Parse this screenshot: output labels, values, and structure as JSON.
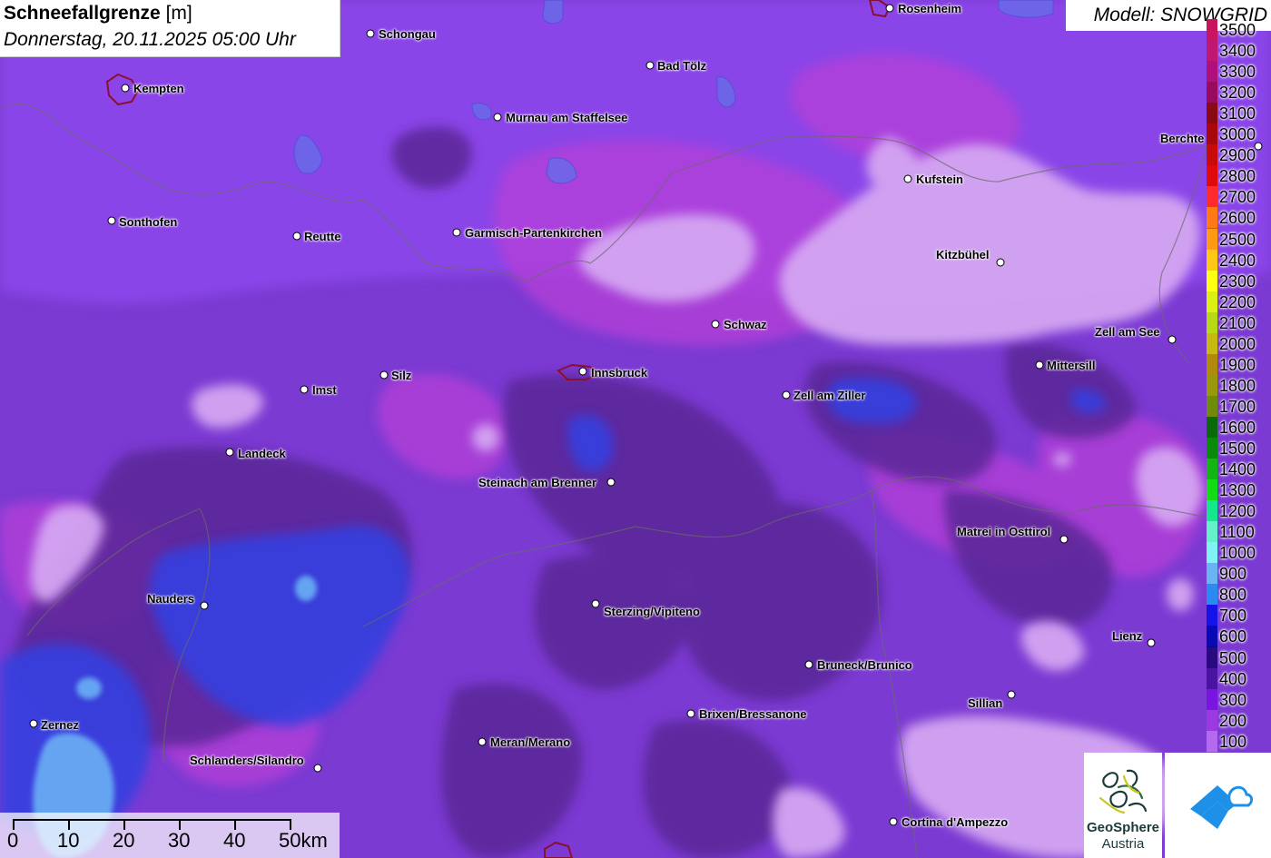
{
  "title": {
    "main": "Schneefallgrenze",
    "unit": "[m]",
    "datetime": "Donnerstag, 20.11.2025 05:00 Uhr"
  },
  "model": {
    "label": "Modell: SNOWGRID"
  },
  "cities": [
    {
      "name": "Rosenheim"
    },
    {
      "name": "Schongau"
    },
    {
      "name": "Bad Tölz"
    },
    {
      "name": "Kempten"
    },
    {
      "name": "Murnau am Staffelsee"
    },
    {
      "name": "Berchte"
    },
    {
      "name": "Kufstein"
    },
    {
      "name": "Sonthofen"
    },
    {
      "name": "Reutte"
    },
    {
      "name": "Garmisch-Partenkirchen"
    },
    {
      "name": "Kitzbühel"
    },
    {
      "name": "Schwaz"
    },
    {
      "name": "Zell am See"
    },
    {
      "name": "Mittersill"
    },
    {
      "name": "Innsbruck"
    },
    {
      "name": "Silz"
    },
    {
      "name": "Imst"
    },
    {
      "name": "Zell am Ziller"
    },
    {
      "name": "Landeck"
    },
    {
      "name": "Steinach am Brenner"
    },
    {
      "name": "Matrei in Osttirol"
    },
    {
      "name": "Nauders"
    },
    {
      "name": "Sterzing/Vipiteno"
    },
    {
      "name": "Lienz"
    },
    {
      "name": "Bruneck/Brunico"
    },
    {
      "name": "Sillian"
    },
    {
      "name": "Brixen/Bressanone"
    },
    {
      "name": "Zernez"
    },
    {
      "name": "Meran/Merano"
    },
    {
      "name": "Schlanders/Silandro"
    },
    {
      "name": "Cortina d'Ampezzo"
    }
  ],
  "legend": {
    "values": [
      "3500",
      "3400",
      "3300",
      "3200",
      "3100",
      "3000",
      "2900",
      "2800",
      "2700",
      "2600",
      "2500",
      "2400",
      "2300",
      "2200",
      "2100",
      "2000",
      "1900",
      "1800",
      "1700",
      "1600",
      "1500",
      "1400",
      "1300",
      "1200",
      "1100",
      "1000",
      "900",
      "800",
      "700",
      "600",
      "500",
      "400",
      "300",
      "200",
      "100"
    ],
    "colors": [
      "#c8155e",
      "#c01870",
      "#b0107a",
      "#9a0a5e",
      "#8a0a14",
      "#a8080c",
      "#c80a0a",
      "#e00a0a",
      "#ff2a2a",
      "#ff7a14",
      "#ff9a14",
      "#ffc814",
      "#ffff14",
      "#d8f014",
      "#b8d814",
      "#c8b814",
      "#b08a0a",
      "#98980a",
      "#708a0a",
      "#0a6a0a",
      "#0a8a0a",
      "#14b414",
      "#14dc14",
      "#14e88a",
      "#64f0c8",
      "#80f4f4",
      "#6ab4f4",
      "#2a8af0",
      "#1414e8",
      "#0a0ab4",
      "#2a0a80",
      "#4a14a0",
      "#7a14e0",
      "#9a3ae0",
      "#b46af0"
    ]
  },
  "scale": {
    "labels": [
      "0",
      "10",
      "20",
      "30",
      "40",
      "50km"
    ]
  },
  "logos": {
    "geosphere_line1": "GeoSphere",
    "geosphere_line2": "Austria"
  },
  "colors": {
    "violet": "#8a3ff0",
    "dark_violet": "#5a2a96",
    "blue": "#3a4ae8",
    "light_lilac": "#d2a4f2",
    "magenta": "#c040d8"
  }
}
